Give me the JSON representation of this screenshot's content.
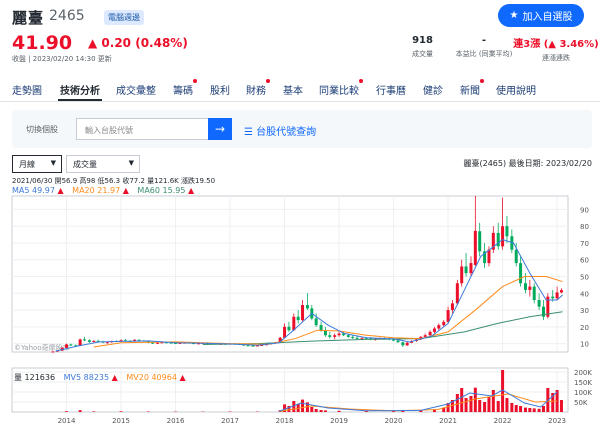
{
  "stock": {
    "name": "麗臺",
    "code": "2465",
    "badge": "電腦週邊",
    "price": "41.90",
    "change": "0.20 (0.48%)",
    "time": "收盤 | 2023/02/20 14:30 更新"
  },
  "stats": [
    {
      "value": "918",
      "label": "成交量"
    },
    {
      "value": "-",
      "label": "本益比 (同業平均)"
    },
    {
      "value": "連3漲 (▲ 3.46%)",
      "label": "連漲連跌"
    }
  ],
  "follow_label": "加入自選股",
  "nav": {
    "tabs": [
      {
        "label": "走勢圖",
        "dot": false
      },
      {
        "label": "技術分析",
        "dot": false,
        "active": true
      },
      {
        "label": "成交彙整",
        "dot": false
      },
      {
        "label": "籌碼",
        "dot": true
      },
      {
        "label": "股利",
        "dot": false
      },
      {
        "label": "財務",
        "dot": true
      },
      {
        "label": "基本",
        "dot": false
      },
      {
        "label": "同業比較",
        "dot": true
      },
      {
        "label": "行事曆",
        "dot": false
      },
      {
        "label": "健診",
        "dot": false
      },
      {
        "label": "新聞",
        "dot": true
      },
      {
        "label": "使用說明",
        "dot": false
      }
    ]
  },
  "search": {
    "label": "切換個股",
    "placeholder": "輸入台股代號",
    "link": "台股代號查詢"
  },
  "controls": {
    "period": "月線",
    "indicator": "成交量"
  },
  "right_info": "麗臺(2465)   最後日期: 2023/02/20",
  "ohlc_line": "2021/06/30 開56.9 高98 低56.3 收77.2 量121.6K 漲跌19.50",
  "ma_info": {
    "ma5": "MA5 49.97",
    "ma20": "MA20 21.97",
    "ma60": "MA60 15.95"
  },
  "vol_info": {
    "vol": "量 121636",
    "mv5": "MV5 88235",
    "mv20": "MV20 40964"
  },
  "watermark": "©Yahoo奇摩股市",
  "colors": {
    "up": "#eb0f29",
    "down": "#00ab5e",
    "ma5": "#3d7bd9",
    "ma20": "#ff8b1a",
    "ma60": "#3b8f6e",
    "brand": "#0f69ff"
  },
  "chart_data": {
    "type": "candlestick",
    "x_ticks": [
      "2014",
      "2015",
      "2016",
      "2017",
      "2018",
      "2019",
      "2020",
      "2021",
      "2022",
      "2023"
    ],
    "y_ticks": [
      10,
      20,
      30,
      40,
      50,
      60,
      70,
      80,
      90
    ],
    "ylim": [
      5,
      98
    ],
    "vol_ticks": [
      "200K",
      "150K",
      "100K",
      "50K"
    ],
    "vol_ylim": [
      0,
      220000
    ],
    "candles": [
      [
        2013.75,
        5,
        5.5,
        4.8,
        5.3
      ],
      [
        2013.83,
        5.3,
        6,
        5.1,
        5.8
      ],
      [
        2013.92,
        5.8,
        8,
        5.6,
        7.5
      ],
      [
        2014.0,
        7.5,
        10,
        7,
        9.5
      ],
      [
        2014.08,
        9.5,
        10,
        8.5,
        9
      ],
      [
        2014.17,
        9,
        9.5,
        8.2,
        8.6
      ],
      [
        2014.25,
        8.6,
        13,
        8.5,
        12.5
      ],
      [
        2014.33,
        12.5,
        14,
        11.5,
        12
      ],
      [
        2014.42,
        12,
        12.5,
        10.5,
        11
      ],
      [
        2014.5,
        11,
        12,
        10.8,
        11.6
      ],
      [
        2014.58,
        11.6,
        12.4,
        11,
        11.3
      ],
      [
        2014.67,
        11.3,
        11.6,
        10.2,
        10.6
      ],
      [
        2014.75,
        10.6,
        11.2,
        10,
        10.8
      ],
      [
        2014.83,
        10.8,
        11.8,
        10.5,
        11.5
      ],
      [
        2014.92,
        11.5,
        12,
        11,
        11.2
      ],
      [
        2015.0,
        11.2,
        12.5,
        11,
        12
      ],
      [
        2015.08,
        12,
        12.8,
        11.5,
        11.8
      ],
      [
        2015.17,
        11.8,
        12,
        11,
        11.4
      ],
      [
        2015.25,
        11.4,
        12.6,
        11.2,
        12.3
      ],
      [
        2015.33,
        12.3,
        12.5,
        11.6,
        11.8
      ],
      [
        2015.42,
        11.8,
        12.2,
        11.2,
        11.5
      ],
      [
        2015.5,
        11.5,
        11.8,
        10.2,
        10.6
      ],
      [
        2015.58,
        10.6,
        11,
        9.8,
        10.2
      ],
      [
        2015.67,
        10.2,
        10.8,
        9.8,
        10.5
      ],
      [
        2015.75,
        10.5,
        11,
        10.2,
        10.8
      ],
      [
        2015.83,
        10.8,
        11.2,
        10.4,
        10.6
      ],
      [
        2015.92,
        10.6,
        11,
        10.2,
        10.4
      ],
      [
        2016.0,
        10.4,
        10.8,
        9.8,
        10.2
      ],
      [
        2016.08,
        10.2,
        10.6,
        9.8,
        10.4
      ],
      [
        2016.17,
        10.4,
        10.8,
        10,
        10.6
      ],
      [
        2016.25,
        10.6,
        11,
        10.2,
        10.3
      ],
      [
        2016.33,
        10.3,
        10.6,
        9.8,
        10
      ],
      [
        2016.42,
        10,
        10.5,
        9.6,
        10.2
      ],
      [
        2016.5,
        10.2,
        10.6,
        9.9,
        10.4
      ],
      [
        2016.58,
        10.4,
        10.8,
        10,
        10.3
      ],
      [
        2016.67,
        10.3,
        10.6,
        9.8,
        10.1
      ],
      [
        2016.75,
        10.1,
        10.4,
        9.6,
        9.8
      ],
      [
        2016.83,
        9.8,
        10.2,
        9.4,
        9.9
      ],
      [
        2016.92,
        9.9,
        10.2,
        9.5,
        9.7
      ],
      [
        2017.0,
        9.7,
        10.2,
        9.4,
        10
      ],
      [
        2017.08,
        10,
        10.4,
        9.6,
        9.8
      ],
      [
        2017.17,
        9.8,
        10.2,
        9.2,
        9.4
      ],
      [
        2017.25,
        9.4,
        9.8,
        8.8,
        9
      ],
      [
        2017.33,
        9,
        9.4,
        8.6,
        8.8
      ],
      [
        2017.42,
        8.8,
        9.2,
        8.4,
        8.6
      ],
      [
        2017.5,
        8.6,
        9,
        8.3,
        8.9
      ],
      [
        2017.58,
        8.9,
        9.4,
        8.6,
        9.2
      ],
      [
        2017.67,
        9.2,
        9.8,
        9,
        9.6
      ],
      [
        2017.75,
        9.6,
        10.5,
        9.4,
        10.2
      ],
      [
        2017.83,
        10.2,
        11,
        9.8,
        10.8
      ],
      [
        2017.92,
        10.8,
        14,
        10.5,
        13.5
      ],
      [
        2018.0,
        13.5,
        22,
        13,
        20
      ],
      [
        2018.08,
        20,
        23,
        17,
        18
      ],
      [
        2018.17,
        18,
        28,
        17.5,
        26
      ],
      [
        2018.25,
        26,
        30,
        22,
        24
      ],
      [
        2018.33,
        24,
        36,
        23,
        33
      ],
      [
        2018.42,
        33,
        40,
        30,
        31
      ],
      [
        2018.5,
        31,
        33,
        24,
        25
      ],
      [
        2018.58,
        25,
        28,
        20,
        21
      ],
      [
        2018.67,
        21,
        23,
        17,
        18
      ],
      [
        2018.75,
        18,
        20,
        14,
        15
      ],
      [
        2018.83,
        15,
        17,
        13,
        14
      ],
      [
        2018.92,
        14,
        16,
        12.5,
        15
      ],
      [
        2019.0,
        15,
        17,
        14,
        16
      ],
      [
        2019.08,
        16,
        17,
        14.5,
        15
      ],
      [
        2019.17,
        15,
        16,
        13.5,
        14
      ],
      [
        2019.25,
        14,
        15,
        12.8,
        13.5
      ],
      [
        2019.33,
        13.5,
        14.5,
        12.5,
        13
      ],
      [
        2019.42,
        13,
        14,
        12.2,
        13.2
      ],
      [
        2019.5,
        13.2,
        14,
        12.5,
        13
      ],
      [
        2019.58,
        13,
        13.8,
        12,
        12.4
      ],
      [
        2019.67,
        12.4,
        13,
        11.8,
        12.8
      ],
      [
        2019.75,
        12.8,
        13.5,
        12.2,
        13.2
      ],
      [
        2019.83,
        13.2,
        14,
        12.5,
        13
      ],
      [
        2019.92,
        13,
        13.6,
        12,
        12.6
      ],
      [
        2020.0,
        12.6,
        13.2,
        11.5,
        11.8
      ],
      [
        2020.08,
        11.8,
        12.4,
        10.5,
        10.8
      ],
      [
        2020.17,
        10.8,
        11.2,
        8,
        9
      ],
      [
        2020.25,
        9,
        11,
        8.6,
        10.5
      ],
      [
        2020.33,
        10.5,
        12,
        10.2,
        11.6
      ],
      [
        2020.42,
        11.6,
        13,
        11,
        12.5
      ],
      [
        2020.5,
        12.5,
        14.5,
        12,
        14
      ],
      [
        2020.58,
        14,
        16,
        13.5,
        15
      ],
      [
        2020.67,
        15,
        18,
        14.5,
        17
      ],
      [
        2020.75,
        17,
        20,
        16,
        19
      ],
      [
        2020.83,
        19,
        22,
        18,
        21
      ],
      [
        2020.92,
        21,
        24,
        20,
        23
      ],
      [
        2021.0,
        23,
        32,
        22,
        30
      ],
      [
        2021.08,
        30,
        36,
        28,
        34
      ],
      [
        2021.17,
        34,
        48,
        33,
        46
      ],
      [
        2021.25,
        46,
        60,
        44,
        56
      ],
      [
        2021.33,
        56,
        64,
        50,
        52
      ],
      [
        2021.42,
        52,
        62,
        50,
        58
      ],
      [
        2021.5,
        56.9,
        98,
        56.3,
        77.2
      ],
      [
        2021.58,
        77,
        82,
        62,
        65
      ],
      [
        2021.67,
        65,
        70,
        55,
        58
      ],
      [
        2021.75,
        58,
        68,
        56,
        66
      ],
      [
        2021.83,
        66,
        80,
        64,
        76
      ],
      [
        2021.92,
        76,
        82,
        66,
        68
      ],
      [
        2022.0,
        68,
        97,
        66,
        80
      ],
      [
        2022.08,
        80,
        86,
        70,
        74
      ],
      [
        2022.17,
        74,
        78,
        64,
        66
      ],
      [
        2022.25,
        66,
        70,
        56,
        58
      ],
      [
        2022.33,
        58,
        62,
        44,
        46
      ],
      [
        2022.42,
        46,
        52,
        40,
        42
      ],
      [
        2022.5,
        42,
        48,
        38,
        44
      ],
      [
        2022.58,
        44,
        46,
        34,
        36
      ],
      [
        2022.67,
        36,
        40,
        30,
        32
      ],
      [
        2022.75,
        32,
        36,
        24,
        26
      ],
      [
        2022.83,
        26,
        40,
        25,
        38
      ],
      [
        2022.92,
        38,
        42,
        35,
        37
      ],
      [
        2023.0,
        37,
        44,
        36,
        40.5
      ],
      [
        2023.08,
        40.5,
        43,
        40,
        41.9
      ]
    ],
    "ma5": [
      [
        2013.8,
        5.5
      ],
      [
        2014.2,
        8.5
      ],
      [
        2014.6,
        11
      ],
      [
        2015.0,
        11.3
      ],
      [
        2015.5,
        11.6
      ],
      [
        2016.0,
        10.5
      ],
      [
        2016.5,
        10.2
      ],
      [
        2017.0,
        9.8
      ],
      [
        2017.5,
        9
      ],
      [
        2017.9,
        10.5
      ],
      [
        2018.2,
        19
      ],
      [
        2018.5,
        28
      ],
      [
        2018.8,
        21
      ],
      [
        2019.1,
        16
      ],
      [
        2019.5,
        13.5
      ],
      [
        2020.0,
        12.8
      ],
      [
        2020.3,
        11
      ],
      [
        2020.7,
        14.5
      ],
      [
        2021.0,
        22
      ],
      [
        2021.3,
        42
      ],
      [
        2021.6,
        62
      ],
      [
        2022.0,
        72
      ],
      [
        2022.2,
        70
      ],
      [
        2022.5,
        52
      ],
      [
        2022.8,
        36
      ],
      [
        2023.0,
        36
      ],
      [
        2023.1,
        39
      ]
    ],
    "ma20": [
      [
        2014.5,
        8
      ],
      [
        2015.0,
        10.5
      ],
      [
        2016.0,
        11
      ],
      [
        2017.0,
        10
      ],
      [
        2017.7,
        9.6
      ],
      [
        2018.2,
        13
      ],
      [
        2018.6,
        18
      ],
      [
        2019.0,
        17.5
      ],
      [
        2019.5,
        15
      ],
      [
        2020.0,
        13.5
      ],
      [
        2020.5,
        13
      ],
      [
        2021.0,
        17
      ],
      [
        2021.5,
        30
      ],
      [
        2022.0,
        44
      ],
      [
        2022.4,
        50
      ],
      [
        2022.8,
        50
      ],
      [
        2023.1,
        47
      ]
    ],
    "ma60": [
      [
        2016.5,
        9.5
      ],
      [
        2017.5,
        10
      ],
      [
        2018.5,
        11.5
      ],
      [
        2019.5,
        12.5
      ],
      [
        2020.5,
        13
      ],
      [
        2021.3,
        17
      ],
      [
        2021.9,
        22
      ],
      [
        2022.5,
        26
      ],
      [
        2023.1,
        29
      ]
    ],
    "volumes": [
      [
        2014.0,
        4000
      ],
      [
        2014.25,
        9000
      ],
      [
        2014.5,
        3000
      ],
      [
        2015.0,
        3500
      ],
      [
        2015.5,
        2500
      ],
      [
        2016.0,
        2000
      ],
      [
        2016.5,
        1800
      ],
      [
        2017.0,
        2200
      ],
      [
        2017.5,
        2000
      ],
      [
        2017.92,
        9000
      ],
      [
        2018.0,
        38000
      ],
      [
        2018.08,
        30000
      ],
      [
        2018.17,
        55000
      ],
      [
        2018.25,
        40000
      ],
      [
        2018.33,
        62000
      ],
      [
        2018.42,
        48000
      ],
      [
        2018.5,
        25000
      ],
      [
        2018.58,
        15000
      ],
      [
        2018.67,
        10000
      ],
      [
        2018.75,
        8000
      ],
      [
        2019.0,
        6000
      ],
      [
        2019.5,
        5000
      ],
      [
        2020.0,
        4500
      ],
      [
        2020.17,
        9000
      ],
      [
        2020.5,
        8000
      ],
      [
        2020.75,
        14000
      ],
      [
        2020.92,
        20000
      ],
      [
        2021.0,
        45000
      ],
      [
        2021.08,
        60000
      ],
      [
        2021.17,
        90000
      ],
      [
        2021.25,
        120000
      ],
      [
        2021.33,
        70000
      ],
      [
        2021.42,
        80000
      ],
      [
        2021.5,
        121636
      ],
      [
        2021.58,
        60000
      ],
      [
        2021.67,
        50000
      ],
      [
        2021.75,
        75000
      ],
      [
        2021.83,
        110000
      ],
      [
        2021.92,
        55000
      ],
      [
        2022.0,
        210000
      ],
      [
        2022.08,
        70000
      ],
      [
        2022.17,
        45000
      ],
      [
        2022.25,
        35000
      ],
      [
        2022.33,
        30000
      ],
      [
        2022.42,
        22000
      ],
      [
        2022.5,
        20000
      ],
      [
        2022.58,
        18000
      ],
      [
        2022.67,
        16000
      ],
      [
        2022.75,
        30000
      ],
      [
        2022.83,
        120000
      ],
      [
        2022.92,
        95000
      ],
      [
        2023.0,
        110000
      ],
      [
        2023.08,
        60000
      ]
    ],
    "mv5": [
      [
        2017.9,
        3000
      ],
      [
        2018.3,
        45000
      ],
      [
        2018.8,
        20000
      ],
      [
        2019.5,
        6000
      ],
      [
        2020.5,
        8000
      ],
      [
        2021.0,
        40000
      ],
      [
        2021.4,
        95000
      ],
      [
        2021.8,
        80000
      ],
      [
        2022.0,
        110000
      ],
      [
        2022.4,
        45000
      ],
      [
        2022.7,
        25000
      ],
      [
        2023.0,
        100000
      ]
    ],
    "mv20": [
      [
        2017.9,
        2500
      ],
      [
        2018.5,
        30000
      ],
      [
        2019.2,
        15000
      ],
      [
        2020.0,
        6000
      ],
      [
        2020.8,
        12000
      ],
      [
        2021.5,
        65000
      ],
      [
        2022.1,
        90000
      ],
      [
        2022.6,
        50000
      ],
      [
        2023.0,
        55000
      ]
    ]
  }
}
